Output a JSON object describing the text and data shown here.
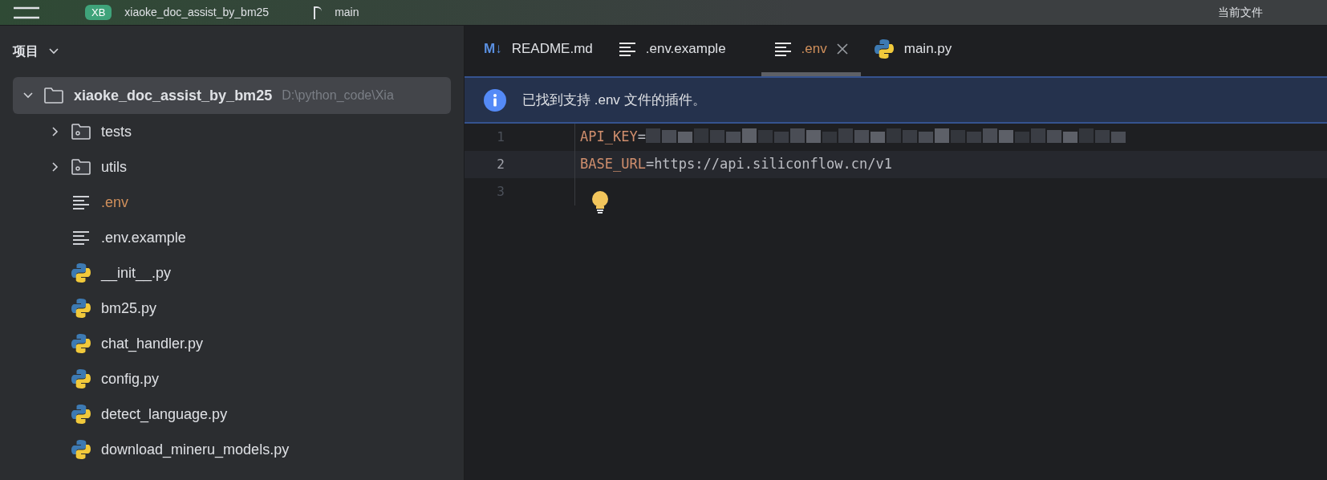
{
  "title_bar": {
    "project_badge": "XB",
    "project": "xiaoke_doc_assist_by_bm25",
    "branch": "main",
    "run_config": "当前文件"
  },
  "sidebar": {
    "title": "项目",
    "tree": {
      "name": "xiaoke_doc_assist_by_bm25",
      "path": "D:\\python_code\\Xia",
      "kind": "folder",
      "expanded": true,
      "selected": true,
      "children": [
        {
          "name": "tests",
          "kind": "folder",
          "expanded": false,
          "ignored": false
        },
        {
          "name": "utils",
          "kind": "folder",
          "expanded": false,
          "ignored": false
        },
        {
          "name": ".env",
          "kind": "text",
          "ignored": true
        },
        {
          "name": ".env.example",
          "kind": "text",
          "ignored": false
        },
        {
          "name": "__init__.py",
          "kind": "python",
          "ignored": false
        },
        {
          "name": "bm25.py",
          "kind": "python",
          "ignored": false
        },
        {
          "name": "chat_handler.py",
          "kind": "python",
          "ignored": false
        },
        {
          "name": "config.py",
          "kind": "python",
          "ignored": false
        },
        {
          "name": "detect_language.py",
          "kind": "python",
          "ignored": false
        },
        {
          "name": "download_mineru_models.py",
          "kind": "python",
          "ignored": false
        }
      ]
    }
  },
  "tabs": [
    {
      "label": "README.md",
      "kind": "markdown",
      "icon_text": "M↓",
      "selected": false,
      "ignored": false
    },
    {
      "label": ".env.example",
      "kind": "text",
      "selected": false,
      "ignored": false
    },
    {
      "label": ".env",
      "kind": "text",
      "selected": true,
      "ignored": true
    },
    {
      "label": "main.py",
      "kind": "python",
      "selected": false,
      "ignored": false
    }
  ],
  "banner": {
    "text": "已找到支持 .env 文件的插件。"
  },
  "code_lines": [
    {
      "number": "1",
      "key": "API_KEY",
      "rest": "=",
      "redacted": true,
      "selected": false,
      "bulb": false
    },
    {
      "number": "2",
      "key": "BASE_URL",
      "rest": "=https://api.siliconflow.cn/v1",
      "redacted": false,
      "selected": true,
      "bulb": false
    },
    {
      "number": "3",
      "redacted": false,
      "selected": false,
      "bulb": true
    }
  ]
}
